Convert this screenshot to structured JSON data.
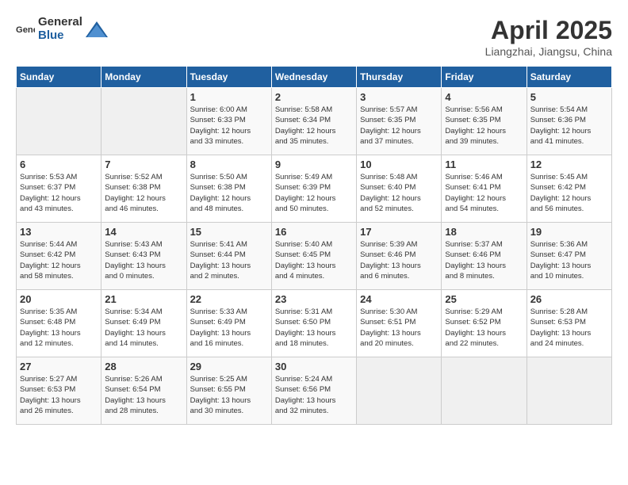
{
  "header": {
    "logo_general": "General",
    "logo_blue": "Blue",
    "title": "April 2025",
    "location": "Liangzhai, Jiangsu, China"
  },
  "days_of_week": [
    "Sunday",
    "Monday",
    "Tuesday",
    "Wednesday",
    "Thursday",
    "Friday",
    "Saturday"
  ],
  "weeks": [
    [
      {
        "day": "",
        "info": ""
      },
      {
        "day": "",
        "info": ""
      },
      {
        "day": "1",
        "info": "Sunrise: 6:00 AM\nSunset: 6:33 PM\nDaylight: 12 hours\nand 33 minutes."
      },
      {
        "day": "2",
        "info": "Sunrise: 5:58 AM\nSunset: 6:34 PM\nDaylight: 12 hours\nand 35 minutes."
      },
      {
        "day": "3",
        "info": "Sunrise: 5:57 AM\nSunset: 6:35 PM\nDaylight: 12 hours\nand 37 minutes."
      },
      {
        "day": "4",
        "info": "Sunrise: 5:56 AM\nSunset: 6:35 PM\nDaylight: 12 hours\nand 39 minutes."
      },
      {
        "day": "5",
        "info": "Sunrise: 5:54 AM\nSunset: 6:36 PM\nDaylight: 12 hours\nand 41 minutes."
      }
    ],
    [
      {
        "day": "6",
        "info": "Sunrise: 5:53 AM\nSunset: 6:37 PM\nDaylight: 12 hours\nand 43 minutes."
      },
      {
        "day": "7",
        "info": "Sunrise: 5:52 AM\nSunset: 6:38 PM\nDaylight: 12 hours\nand 46 minutes."
      },
      {
        "day": "8",
        "info": "Sunrise: 5:50 AM\nSunset: 6:38 PM\nDaylight: 12 hours\nand 48 minutes."
      },
      {
        "day": "9",
        "info": "Sunrise: 5:49 AM\nSunset: 6:39 PM\nDaylight: 12 hours\nand 50 minutes."
      },
      {
        "day": "10",
        "info": "Sunrise: 5:48 AM\nSunset: 6:40 PM\nDaylight: 12 hours\nand 52 minutes."
      },
      {
        "day": "11",
        "info": "Sunrise: 5:46 AM\nSunset: 6:41 PM\nDaylight: 12 hours\nand 54 minutes."
      },
      {
        "day": "12",
        "info": "Sunrise: 5:45 AM\nSunset: 6:42 PM\nDaylight: 12 hours\nand 56 minutes."
      }
    ],
    [
      {
        "day": "13",
        "info": "Sunrise: 5:44 AM\nSunset: 6:42 PM\nDaylight: 12 hours\nand 58 minutes."
      },
      {
        "day": "14",
        "info": "Sunrise: 5:43 AM\nSunset: 6:43 PM\nDaylight: 13 hours\nand 0 minutes."
      },
      {
        "day": "15",
        "info": "Sunrise: 5:41 AM\nSunset: 6:44 PM\nDaylight: 13 hours\nand 2 minutes."
      },
      {
        "day": "16",
        "info": "Sunrise: 5:40 AM\nSunset: 6:45 PM\nDaylight: 13 hours\nand 4 minutes."
      },
      {
        "day": "17",
        "info": "Sunrise: 5:39 AM\nSunset: 6:46 PM\nDaylight: 13 hours\nand 6 minutes."
      },
      {
        "day": "18",
        "info": "Sunrise: 5:37 AM\nSunset: 6:46 PM\nDaylight: 13 hours\nand 8 minutes."
      },
      {
        "day": "19",
        "info": "Sunrise: 5:36 AM\nSunset: 6:47 PM\nDaylight: 13 hours\nand 10 minutes."
      }
    ],
    [
      {
        "day": "20",
        "info": "Sunrise: 5:35 AM\nSunset: 6:48 PM\nDaylight: 13 hours\nand 12 minutes."
      },
      {
        "day": "21",
        "info": "Sunrise: 5:34 AM\nSunset: 6:49 PM\nDaylight: 13 hours\nand 14 minutes."
      },
      {
        "day": "22",
        "info": "Sunrise: 5:33 AM\nSunset: 6:49 PM\nDaylight: 13 hours\nand 16 minutes."
      },
      {
        "day": "23",
        "info": "Sunrise: 5:31 AM\nSunset: 6:50 PM\nDaylight: 13 hours\nand 18 minutes."
      },
      {
        "day": "24",
        "info": "Sunrise: 5:30 AM\nSunset: 6:51 PM\nDaylight: 13 hours\nand 20 minutes."
      },
      {
        "day": "25",
        "info": "Sunrise: 5:29 AM\nSunset: 6:52 PM\nDaylight: 13 hours\nand 22 minutes."
      },
      {
        "day": "26",
        "info": "Sunrise: 5:28 AM\nSunset: 6:53 PM\nDaylight: 13 hours\nand 24 minutes."
      }
    ],
    [
      {
        "day": "27",
        "info": "Sunrise: 5:27 AM\nSunset: 6:53 PM\nDaylight: 13 hours\nand 26 minutes."
      },
      {
        "day": "28",
        "info": "Sunrise: 5:26 AM\nSunset: 6:54 PM\nDaylight: 13 hours\nand 28 minutes."
      },
      {
        "day": "29",
        "info": "Sunrise: 5:25 AM\nSunset: 6:55 PM\nDaylight: 13 hours\nand 30 minutes."
      },
      {
        "day": "30",
        "info": "Sunrise: 5:24 AM\nSunset: 6:56 PM\nDaylight: 13 hours\nand 32 minutes."
      },
      {
        "day": "",
        "info": ""
      },
      {
        "day": "",
        "info": ""
      },
      {
        "day": "",
        "info": ""
      }
    ]
  ]
}
